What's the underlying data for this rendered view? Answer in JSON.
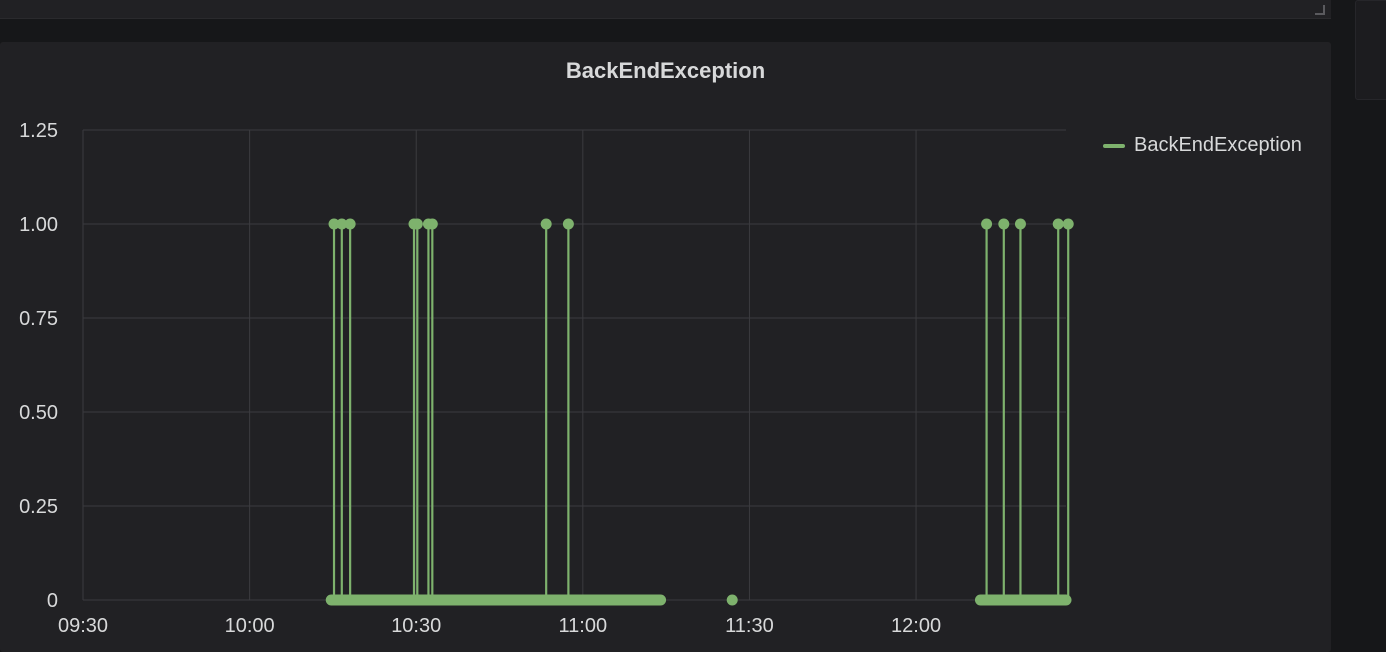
{
  "panel": {
    "title": "BackEndException"
  },
  "chart_data": {
    "type": "line",
    "title": "BackEndException",
    "xlabel": "",
    "ylabel": "",
    "x_ticks": [
      "09:30",
      "10:00",
      "10:30",
      "11:00",
      "11:30",
      "12:00"
    ],
    "x_tick_minutes": [
      0,
      30,
      60,
      90,
      120,
      150
    ],
    "xlim_minutes": [
      0,
      177
    ],
    "y_ticks": [
      "0",
      "0.25",
      "0.50",
      "0.75",
      "1.00",
      "1.25"
    ],
    "y_tick_values": [
      0,
      0.25,
      0.5,
      0.75,
      1.0,
      1.25
    ],
    "ylim": [
      0,
      1.25
    ],
    "grid": true,
    "legend": "right",
    "series": [
      {
        "name": "BackEndException",
        "color": "#7eb26d",
        "segments": [
          {
            "x_start": 44.7,
            "x_end": 104.0,
            "peaks": [
              45.2,
              46.6,
              48.1,
              59.6,
              60.2,
              62.2,
              62.9,
              83.4,
              87.4
            ]
          },
          {
            "x_start": 116.9,
            "x_end": 116.9,
            "peaks": []
          },
          {
            "x_start": 161.6,
            "x_end": 177.0,
            "peaks": [
              162.7,
              165.8,
              168.8,
              175.6,
              177.4
            ]
          }
        ]
      }
    ]
  }
}
